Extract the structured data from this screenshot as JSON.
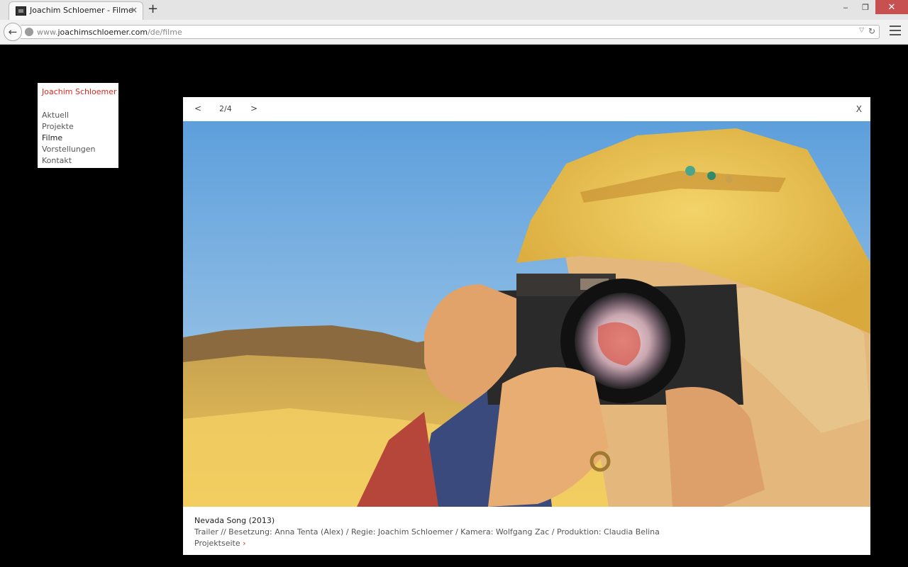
{
  "browser": {
    "tab_title": "Joachim Schloemer - Filme",
    "tab_close": "×",
    "new_tab": "+",
    "url_prefix": "www.",
    "url_domain": "joachimschloemer.com",
    "url_path": "/de/filme",
    "window": {
      "minimize": "‒",
      "restore": "❐",
      "close": "✕"
    }
  },
  "site": {
    "title": "Joachim Schloemer",
    "nav": [
      {
        "label": "Aktuell",
        "active": false
      },
      {
        "label": "Projekte",
        "active": false
      },
      {
        "label": "Filme",
        "active": true
      },
      {
        "label": "Vorstellungen",
        "active": false
      },
      {
        "label": "Kontakt",
        "active": false
      }
    ]
  },
  "lightbox": {
    "prev": "<",
    "counter": "2/4",
    "next": ">",
    "close": "X",
    "image_alt": "",
    "caption": {
      "title": "Nevada Song (2013)",
      "description": "Trailer // Besetzung: Anna Tenta (Alex) / Regie: Joachim Schloemer / Kamera: Wolfgang Zac / Produktion: Claudia Belina",
      "link_label": "Projektseite",
      "link_arrow": "›"
    }
  },
  "colors": {
    "accent": "#e0261c",
    "page_bg": "#000000"
  }
}
